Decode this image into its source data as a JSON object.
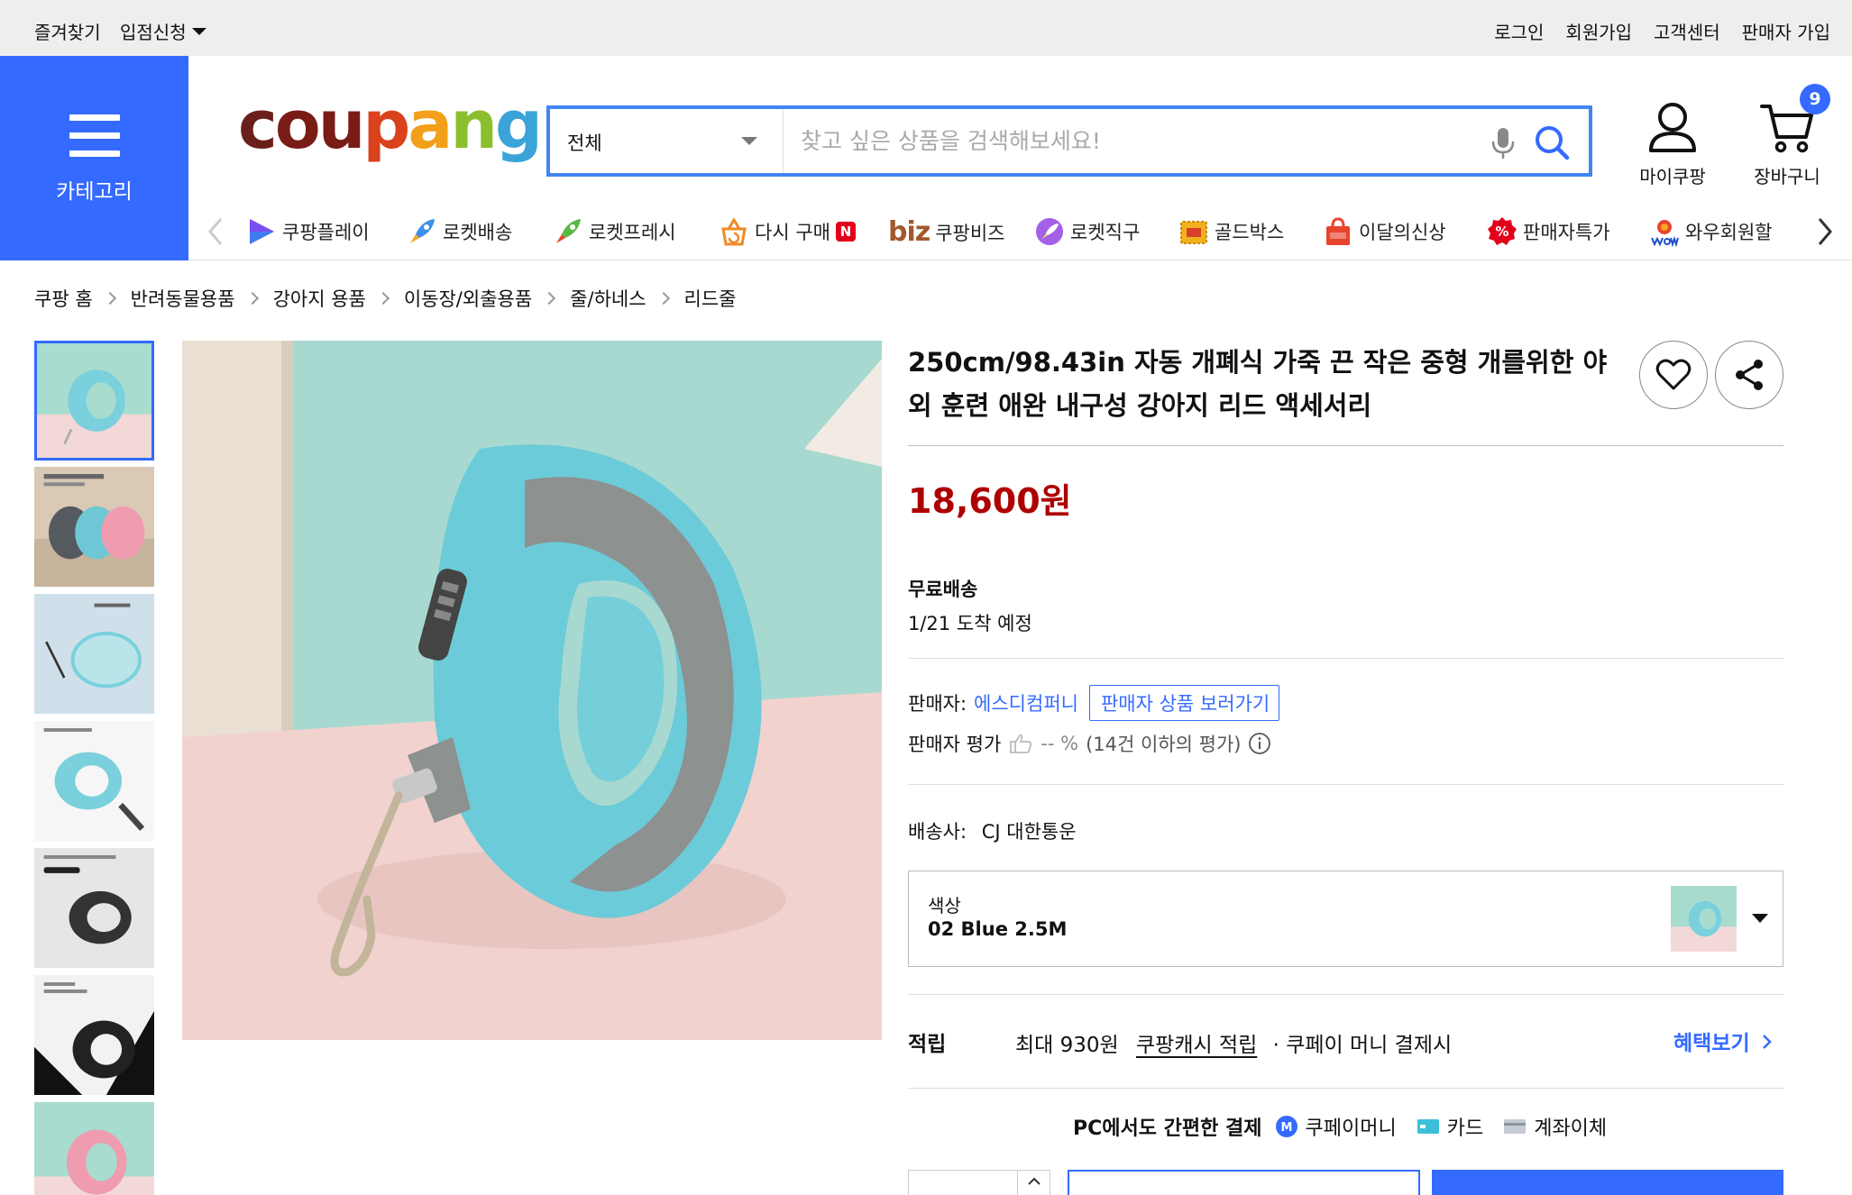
{
  "topbar": {
    "bookmark": "즐겨찾기",
    "store_apply": "입점신청",
    "login": "로그인",
    "signup": "회원가입",
    "customer_center": "고객센터",
    "seller_signup": "판매자 가입"
  },
  "header": {
    "category_label": "카테고리",
    "logo_text": [
      "c",
      "o",
      "u",
      "p",
      "a",
      "n",
      "g"
    ],
    "search_category": "전체",
    "search_placeholder": "찾고 싶은 상품을 검색해보세요!",
    "mycoupang_label": "마이쿠팡",
    "cart_label": "장바구니",
    "cart_count": "9"
  },
  "services": [
    {
      "label": "쿠팡플레이",
      "icon": "coupang-play-icon"
    },
    {
      "label": "로켓배송",
      "icon": "rocket-delivery-icon"
    },
    {
      "label": "로켓프레시",
      "icon": "rocket-fresh-icon"
    },
    {
      "label": "다시 구매",
      "icon": "rebuy-icon",
      "badge": "N"
    },
    {
      "label": "쿠팡비즈",
      "icon": "biz-icon",
      "prefix": "biz"
    },
    {
      "label": "로켓직구",
      "icon": "rocket-global-icon"
    },
    {
      "label": "골드박스",
      "icon": "goldbox-icon"
    },
    {
      "label": "이달의신상",
      "icon": "new-arrivals-icon"
    },
    {
      "label": "판매자특가",
      "icon": "seller-deal-icon"
    },
    {
      "label": "와우회원할",
      "icon": "wow-icon"
    }
  ],
  "breadcrumb": [
    "쿠팡 홈",
    "반려동물용품",
    "강아지 용품",
    "이동장/외출용품",
    "줄/하네스",
    "리드줄"
  ],
  "product": {
    "title": "250cm/98.43in 자동 개폐식 가죽 끈 작은 중형 개를위한 야외 훈련 애완 내구성 강아지 리드 액세서리",
    "price": "18,600원",
    "shipping": "무료배송",
    "arrival": "1/21 도착 예정",
    "seller_label": "판매자:",
    "seller_name": "에스디컴퍼니",
    "seller_link": "판매자 상품 보러가기",
    "seller_rating_label": "판매자 평가",
    "seller_rating_value": "-- %",
    "seller_rating_note": "(14건 이하의 평가)",
    "carrier_label": "배송사:",
    "carrier_name": "CJ 대한통운",
    "option_label": "색상",
    "option_value": "02 Blue 2.5M",
    "reward_title": "적립",
    "reward_max": "최대 930원",
    "reward_link": "쿠팡캐시 적립",
    "reward_suffix": "· 쿠페이 머니 결제시",
    "benefit_link": "혜택보기",
    "pay_title": "PC에서도 간편한 결제",
    "pay_methods": [
      "쿠페이머니",
      "카드",
      "계좌이체"
    ]
  },
  "colors": {
    "accent": "#346aff",
    "price": "#ae0000",
    "leash_blue": "#7ad0dc",
    "leash_gray": "#8d9190"
  }
}
